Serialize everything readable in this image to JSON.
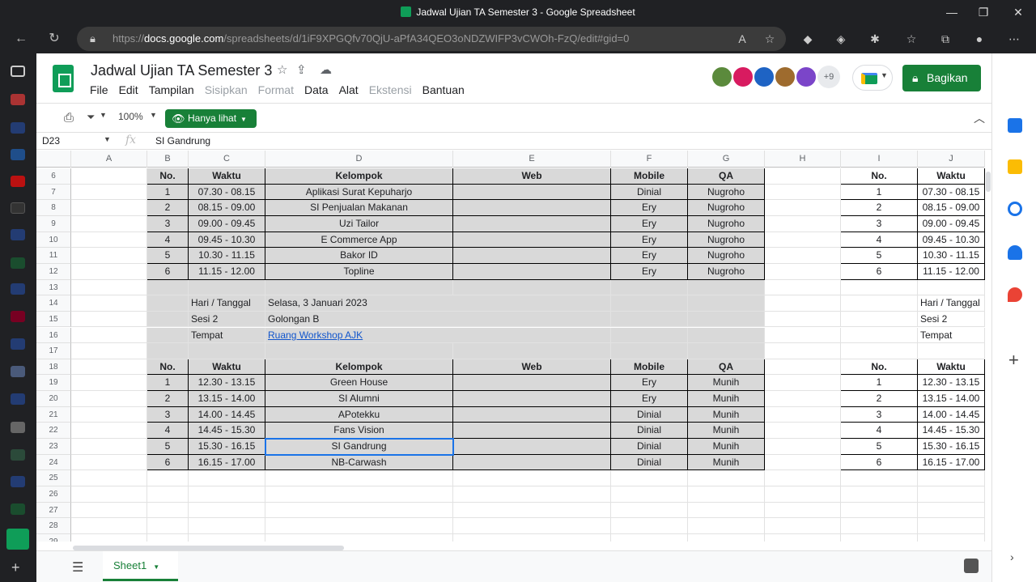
{
  "window": {
    "title": "Jadwal Ujian TA Semester 3 - Google Spreadsheet"
  },
  "browser": {
    "url_prefix": "https://",
    "url_domain": "docs.google.com",
    "url_path": "/spreadsheets/d/1iF9XPGQfv70QjU-aPfA34QEO3oNDZWIFP3vCWOh-FzQ/edit#gid=0"
  },
  "doc": {
    "title": "Jadwal Ujian TA Semester 3"
  },
  "menu": [
    {
      "label": "File",
      "disabled": false
    },
    {
      "label": "Edit",
      "disabled": false
    },
    {
      "label": "Tampilan",
      "disabled": false
    },
    {
      "label": "Sisipkan",
      "disabled": true
    },
    {
      "label": "Format",
      "disabled": true
    },
    {
      "label": "Data",
      "disabled": false
    },
    {
      "label": "Alat",
      "disabled": false
    },
    {
      "label": "Ekstensi",
      "disabled": true
    },
    {
      "label": "Bantuan",
      "disabled": false
    }
  ],
  "collaborators": {
    "more": "+9",
    "colors": [
      "#5b8a3c",
      "#d81b60",
      "#1e63c4",
      "#9e6b2e",
      "#7b45c9"
    ]
  },
  "share_label": "Bagikan",
  "toolbar": {
    "zoom": "100%",
    "mode": "Hanya lihat"
  },
  "formula_bar": {
    "name_box": "D23",
    "value": "SI Gandrung"
  },
  "columns": [
    "A",
    "B",
    "C",
    "D",
    "E",
    "F",
    "G",
    "H",
    "I",
    "J"
  ],
  "rows": [
    "6",
    "7",
    "8",
    "9",
    "10",
    "11",
    "12",
    "13",
    "14",
    "15",
    "16",
    "17",
    "18",
    "19",
    "20",
    "21",
    "22",
    "23",
    "24",
    "25",
    "26",
    "27",
    "28",
    "29"
  ],
  "headers": {
    "no": "No.",
    "waktu": "Waktu",
    "kelompok": "Kelompok",
    "web": "Web",
    "mobile": "Mobile",
    "qa": "QA"
  },
  "session1": [
    {
      "no": "1",
      "waktu": "07.30 - 08.15",
      "kelompok": "Aplikasi Surat Kepuharjo",
      "web": "",
      "mobile": "Dinial",
      "qa": "Nugroho"
    },
    {
      "no": "2",
      "waktu": "08.15 - 09.00",
      "kelompok": "SI Penjualan Makanan",
      "web": "",
      "mobile": "Ery",
      "qa": "Nugroho"
    },
    {
      "no": "3",
      "waktu": "09.00 - 09.45",
      "kelompok": "Uzi Tailor",
      "web": "",
      "mobile": "Ery",
      "qa": "Nugroho"
    },
    {
      "no": "4",
      "waktu": "09.45 - 10.30",
      "kelompok": "E Commerce App",
      "web": "",
      "mobile": "Ery",
      "qa": "Nugroho"
    },
    {
      "no": "5",
      "waktu": "10.30 - 11.15",
      "kelompok": "Bakor ID",
      "web": "",
      "mobile": "Ery",
      "qa": "Nugroho"
    },
    {
      "no": "6",
      "waktu": "11.15 - 12.00",
      "kelompok": "Topline",
      "web": "",
      "mobile": "Ery",
      "qa": "Nugroho"
    }
  ],
  "info": [
    {
      "label": "Hari / Tanggal",
      "value": "Selasa, 3 Januari 2023",
      "link": false
    },
    {
      "label": "Sesi 2",
      "value": "Golongan B",
      "link": false
    },
    {
      "label": "Tempat",
      "value": "Ruang Workshop AJK",
      "link": true
    }
  ],
  "session2": [
    {
      "no": "1",
      "waktu": "12.30 - 13.15",
      "kelompok": "Green House",
      "web": "",
      "mobile": "Ery",
      "qa": "Munih"
    },
    {
      "no": "2",
      "waktu": "13.15 - 14.00",
      "kelompok": "SI Alumni",
      "web": "",
      "mobile": "Ery",
      "qa": "Munih"
    },
    {
      "no": "3",
      "waktu": "14.00 - 14.45",
      "kelompok": "APotekku",
      "web": "",
      "mobile": "Dinial",
      "qa": "Munih"
    },
    {
      "no": "4",
      "waktu": "14.45 - 15.30",
      "kelompok": "Fans Vision",
      "web": "",
      "mobile": "Dinial",
      "qa": "Munih"
    },
    {
      "no": "5",
      "waktu": "15.30 - 16.15",
      "kelompok": "SI Gandrung",
      "web": "",
      "mobile": "Dinial",
      "qa": "Munih"
    },
    {
      "no": "6",
      "waktu": "16.15 - 17.00",
      "kelompok": "NB-Carwash",
      "web": "",
      "mobile": "Dinial",
      "qa": "Munih"
    }
  ],
  "right_info": [
    "Hari / Tanggal",
    "Sesi 2",
    "Tempat"
  ],
  "sheet_tab": "Sheet1"
}
